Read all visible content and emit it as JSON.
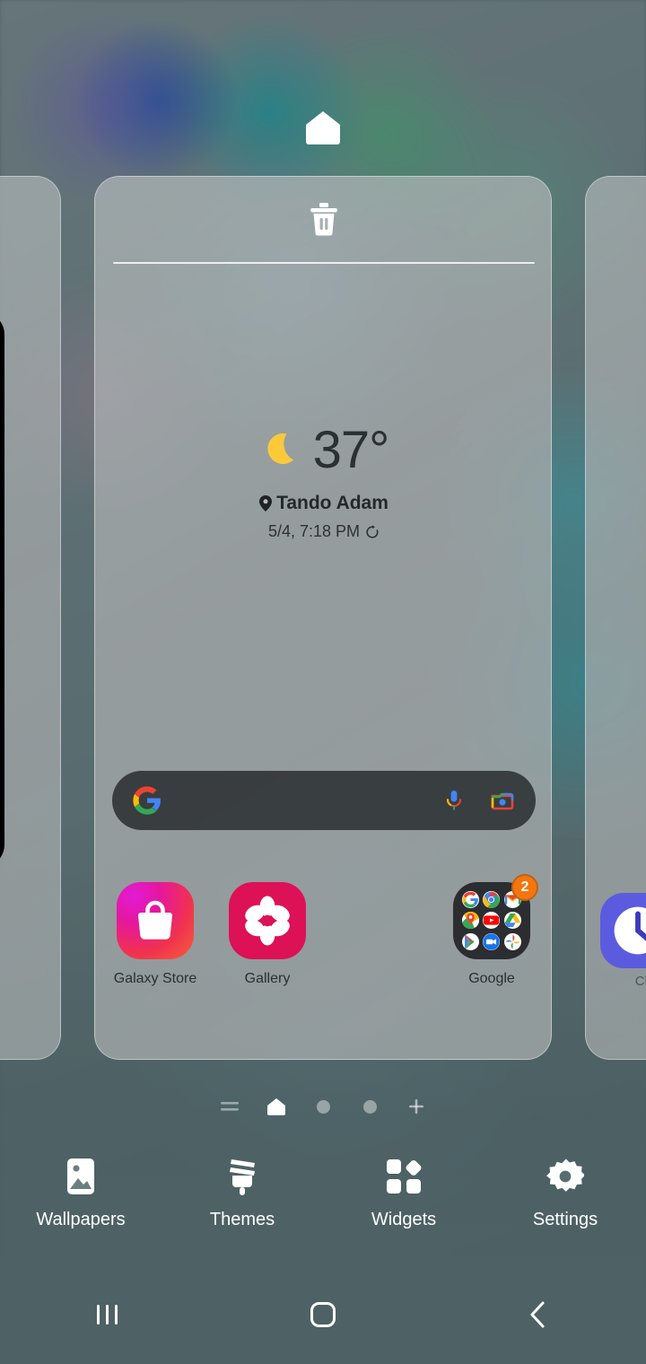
{
  "screen": {
    "mode": "home-screen-edit",
    "background_color": "#566a6d"
  },
  "home_marker": {
    "icon": "home-icon",
    "tooltip": "Home screen"
  },
  "page_card": {
    "delete_icon": "trash-icon",
    "weather_widget": {
      "condition_icon": "crescent-moon-icon",
      "temperature": "37°",
      "location": "Tando Adam",
      "location_icon": "location-pin-icon",
      "updated": "5/4, 7:18 PM",
      "refresh_icon": "refresh-icon"
    },
    "search_bar": {
      "logo_icon": "google-g-icon",
      "placeholder": "",
      "value": "",
      "mic_icon": "microphone-icon",
      "lens_icon": "google-lens-camera-icon"
    },
    "apps": [
      {
        "label": "Galaxy Store",
        "icon": "galaxy-store-icon",
        "badge": ""
      },
      {
        "label": "Gallery",
        "icon": "gallery-icon",
        "badge": ""
      },
      {
        "label": "Google",
        "icon": "google-folder-icon",
        "badge": "2",
        "folder_apps": [
          "google",
          "chrome",
          "gmail",
          "maps",
          "youtube",
          "drive",
          "play-store",
          "meet",
          "photos"
        ]
      }
    ]
  },
  "side_pages": {
    "right_app_label": "Clo"
  },
  "page_indicator": {
    "items": [
      {
        "name": "app-list-icon",
        "state": "inactive"
      },
      {
        "name": "home-page-icon",
        "state": "active"
      },
      {
        "name": "page-dot",
        "state": "inactive"
      },
      {
        "name": "page-dot",
        "state": "inactive"
      },
      {
        "name": "add-page-icon",
        "state": "inactive"
      }
    ]
  },
  "toolbar": {
    "items": [
      {
        "label": "Wallpapers",
        "icon": "wallpaper-icon"
      },
      {
        "label": "Themes",
        "icon": "paintbrush-icon"
      },
      {
        "label": "Widgets",
        "icon": "widgets-grid-icon"
      },
      {
        "label": "Settings",
        "icon": "gear-icon"
      }
    ]
  },
  "navbar": {
    "recents": "recents-icon",
    "home": "home-square-icon",
    "back": "back-chevron-icon"
  },
  "colors": {
    "accent_badge": "#f4760d",
    "galaxy_store": "#e5179f",
    "gallery": "#dd1155",
    "folder_bg": "#2b2d31",
    "search_bg": "#343739"
  }
}
